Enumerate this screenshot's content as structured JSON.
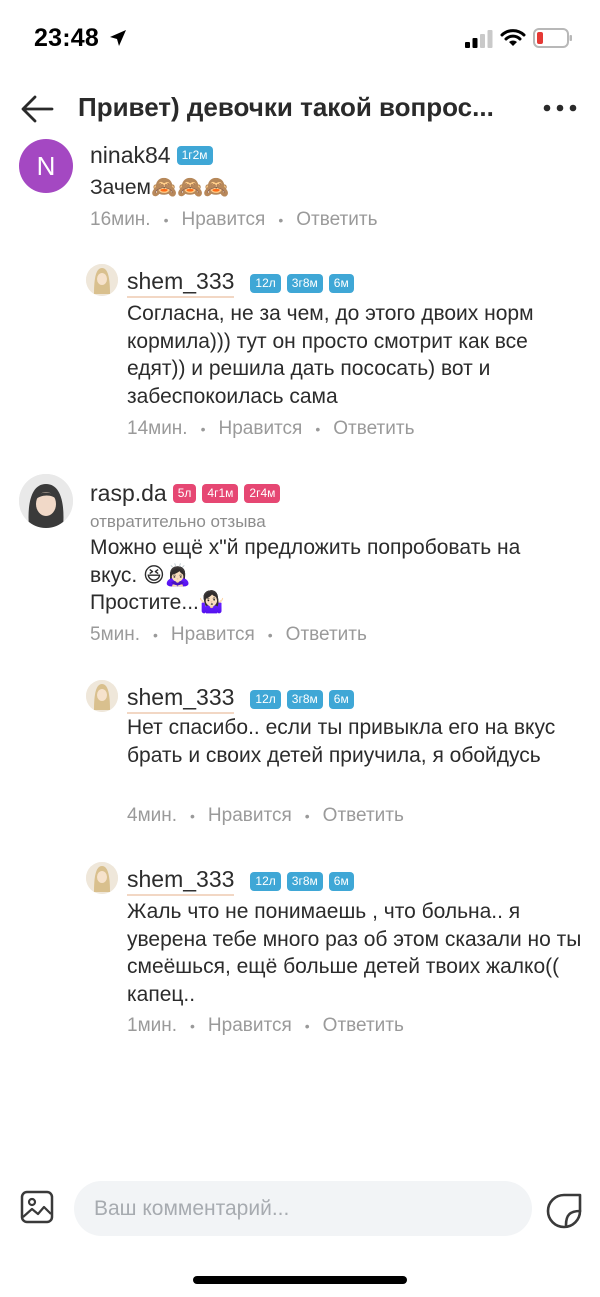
{
  "status_bar": {
    "time": "23:48"
  },
  "header": {
    "title": "Привет) девочки такой вопрос..."
  },
  "comments": [
    {
      "username": "ninak84",
      "avatar_letter": "N",
      "avatar_color": "#a448c2",
      "badges": [
        "1г2м"
      ],
      "text": "Зачем🙈🙈🙈",
      "time": "16мин.",
      "like_label": "Нравится",
      "reply_label": "Ответить",
      "replies": [
        {
          "username": "shem_333",
          "badges": [
            "12л",
            "3г8м",
            "6м"
          ],
          "text": "Согласна, не за чем, до этого двоих норм кормила))) тут он просто смотрит как все едят)) и решила дать пососать) вот и забеспокоилась сама",
          "time": "14мин.",
          "like_label": "Нравится",
          "reply_label": "Ответить"
        }
      ]
    },
    {
      "username": "rasp.da",
      "badges": [
        "5л",
        "4г1м",
        "2г4м"
      ],
      "subtitle": "отвратительно отзыва",
      "text_lines": [
        "Можно ещё х\"й предложить попробовать на",
        "вкус. 😆🙇🏻‍♀️",
        "Простите...🤷🏻‍♀️"
      ],
      "time": "5мин.",
      "like_label": "Нравится",
      "reply_label": "Ответить",
      "replies": [
        {
          "username": "shem_333",
          "badges": [
            "12л",
            "3г8м",
            "6м"
          ],
          "text": "Нет спасибо.. если ты привыкла его на вкус брать и своих детей приучила, я обойдусь",
          "time": "4мин.",
          "like_label": "Нравится",
          "reply_label": "Ответить"
        },
        {
          "username": "shem_333",
          "badges": [
            "12л",
            "3г8м",
            "6м"
          ],
          "text": "Жаль что не понимаешь , что больна.. я уверена тебе много раз об этом сказали но ты смеёшься, ещё больше детей твоих жалко(( капец..",
          "time": "1мин.",
          "like_label": "Нравится",
          "reply_label": "Ответить"
        }
      ]
    }
  ],
  "badge_colors": {
    "blue": "#3fa7d6",
    "red": "#e64773"
  },
  "input": {
    "placeholder": "Ваш комментарий..."
  },
  "icons": {
    "status": [
      "location-arrow-icon",
      "signal-icon",
      "wifi-icon",
      "battery-low-icon"
    ],
    "header": [
      "back-arrow-icon",
      "more-dots-icon"
    ],
    "bottom": [
      "image-icon",
      "sticker-icon"
    ]
  }
}
